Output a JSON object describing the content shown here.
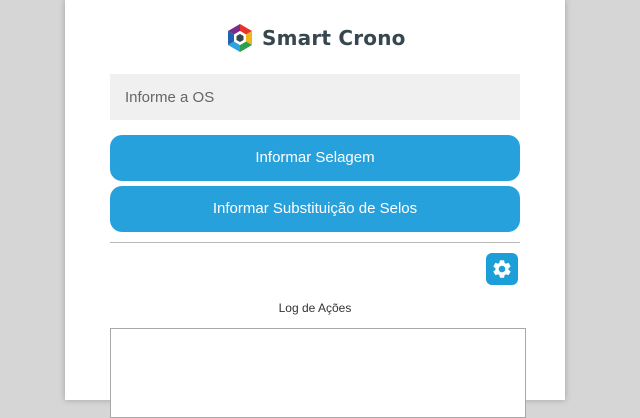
{
  "brand": {
    "name": "Smart Crono",
    "logo_colors": [
      "#1f63b0",
      "#2ea3df",
      "#2e9e4f",
      "#f2b51a",
      "#e5342b",
      "#7a2c8c"
    ]
  },
  "form": {
    "os_input": {
      "placeholder": "Informe a OS",
      "value": ""
    },
    "buttons": {
      "selagem": "Informar Selagem",
      "substituicao": "Informar Substituição de Selos"
    },
    "settings_icon": "gear-icon"
  },
  "log": {
    "label": "Log de Ações",
    "content": ""
  },
  "colors": {
    "accent": "#27a1dc",
    "input_bg": "#f0f0f0"
  }
}
